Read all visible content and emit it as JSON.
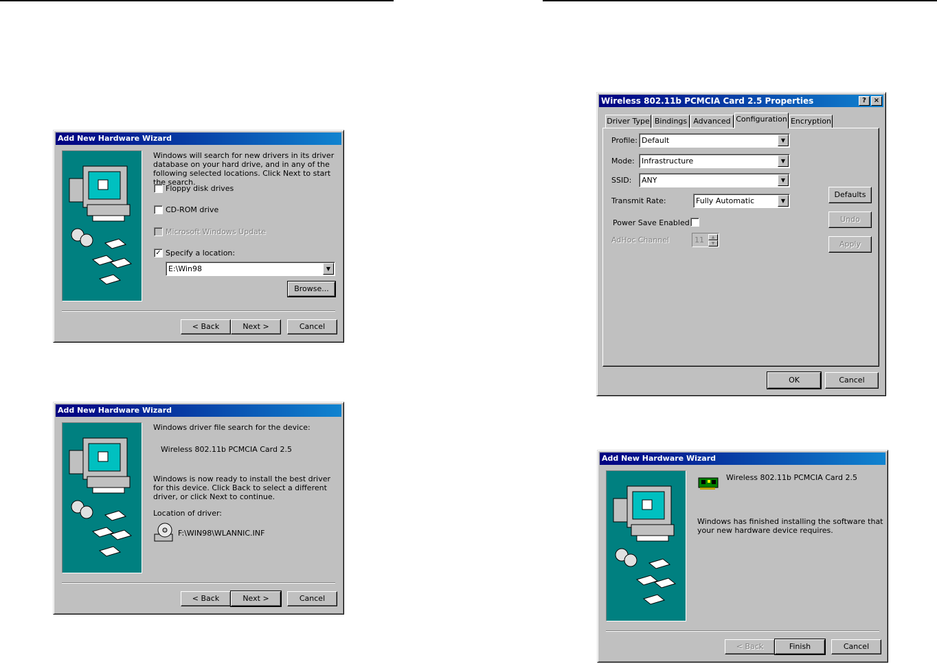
{
  "wizard1": {
    "title": "Add New Hardware Wizard",
    "intro": "Windows will search for new drivers in its driver database on your hard drive, and in any of the following selected locations. Click Next to start the search.",
    "options": [
      {
        "label": "Floppy disk drives",
        "checked": false,
        "enabled": true
      },
      {
        "label": "CD-ROM drive",
        "checked": false,
        "enabled": true
      },
      {
        "label": "Microsoft Windows Update",
        "checked": false,
        "enabled": false
      },
      {
        "label": "Specify a location:",
        "checked": true,
        "enabled": true
      }
    ],
    "location_value": "E:\\Win98",
    "browse_label": "Browse...",
    "back_label": "< Back",
    "next_label": "Next >",
    "cancel_label": "Cancel"
  },
  "wizard2": {
    "title": "Add New Hardware Wizard",
    "line1": "Windows driver file search for the device:",
    "device_name": "Wireless 802.11b PCMCIA Card 2.5",
    "line2": "Windows is now ready to install the best driver for this device. Click Back to select a different driver, or click Next to continue.",
    "location_label": "Location of driver:",
    "driver_path": "F:\\WIN98\\WLANNIC.INF",
    "back_label": "< Back",
    "next_label": "Next >",
    "cancel_label": "Cancel"
  },
  "properties": {
    "title": "Wireless 802.11b PCMCIA Card 2.5 Properties",
    "help_label": "?",
    "close_label": "×",
    "tabs": [
      "Driver Type",
      "Bindings",
      "Advanced",
      "Configuration",
      "Encryption"
    ],
    "active_tab": "Configuration",
    "fields": {
      "profile_label": "Profile:",
      "profile_value": "Default",
      "mode_label": "Mode:",
      "mode_value": "Infrastructure",
      "ssid_label": "SSID:",
      "ssid_value": "ANY",
      "rate_label": "Transmit Rate:",
      "rate_value": "Fully Automatic",
      "power_save_label": "Power Save Enabled",
      "power_save_checked": false,
      "adhoc_label": "AdHoc Channel",
      "adhoc_value": "11"
    },
    "defaults_label": "Defaults",
    "undo_label": "Undo",
    "apply_label": "Apply",
    "ok_label": "OK",
    "cancel_label": "Cancel"
  },
  "wizard3": {
    "title": "Add New Hardware Wizard",
    "device_name": "Wireless 802.11b PCMCIA Card 2.5",
    "message": "Windows has finished installing the software that your new hardware device requires.",
    "back_label": "< Back",
    "finish_label": "Finish",
    "cancel_label": "Cancel"
  },
  "colors": {
    "face": "#c0c0c0",
    "title_start": "#000080",
    "title_end": "#1084d0",
    "art_bg": "#008080"
  },
  "icons": [
    "computer-illustration",
    "cd-disc-icon",
    "floppy-disk-icon",
    "cd-drive-icon",
    "network-card-icon",
    "help-icon",
    "close-icon",
    "dropdown-arrow-icon",
    "checkmark-icon"
  ]
}
